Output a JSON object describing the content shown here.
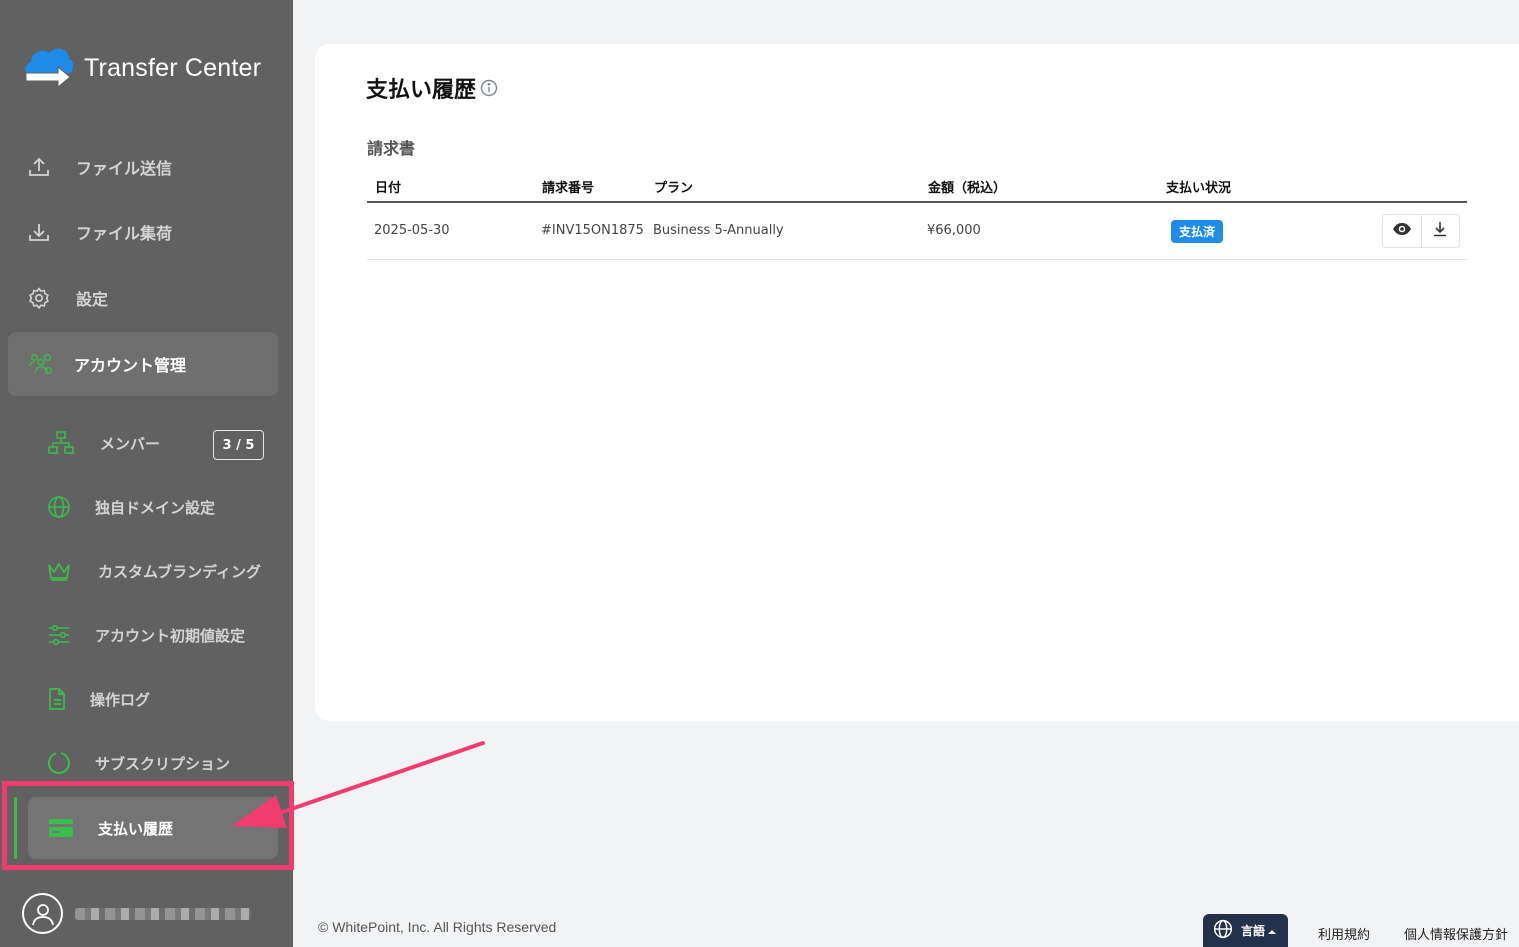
{
  "brand": {
    "name": "Transfer Center"
  },
  "sidebar": {
    "items": [
      {
        "label": "ファイル送信",
        "icon": "upload-icon"
      },
      {
        "label": "ファイル集荷",
        "icon": "download-icon"
      },
      {
        "label": "設定",
        "icon": "gear-icon"
      },
      {
        "label": "アカウント管理",
        "icon": "users-icon"
      }
    ],
    "sub_items": [
      {
        "label": "メンバー",
        "icon": "org-chart-icon",
        "badge": "3 / 5"
      },
      {
        "label": "独自ドメイン設定",
        "icon": "globe-icon"
      },
      {
        "label": "カスタムブランディング",
        "icon": "crown-icon"
      },
      {
        "label": "アカウント初期値設定",
        "icon": "sliders-icon"
      },
      {
        "label": "操作ログ",
        "icon": "document-icon"
      },
      {
        "label": "サブスクリプション",
        "icon": "circle-icon"
      },
      {
        "label": "支払い履歴",
        "icon": "credit-card-icon"
      }
    ]
  },
  "main": {
    "title": "支払い履歴",
    "section_title": "請求書",
    "table": {
      "headers": [
        "日付",
        "請求番号",
        "プラン",
        "金額（税込）",
        "支払い状況"
      ],
      "rows": [
        {
          "date": "2025-05-30",
          "invoice_no": "#INV15ON1875",
          "plan": "Business 5-Annually",
          "amount": "¥66,000",
          "status": "支払済"
        }
      ]
    }
  },
  "footer": {
    "copyright": "© WhitePoint, Inc. All Rights Reserved",
    "language_label": "言語",
    "terms": "利用規約",
    "privacy": "個人情報保護方針"
  },
  "colors": {
    "sidebar_bg": "#616161",
    "accent_green": "#3bbd4a",
    "paid_badge": "#1e8ce8",
    "highlight": "#f23b6e"
  }
}
